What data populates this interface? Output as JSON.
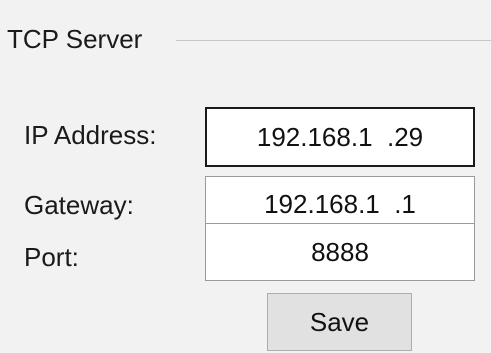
{
  "group": {
    "title": "TCP Server"
  },
  "fields": {
    "ip": {
      "label": "IP Address:",
      "value": "192.168.1  .29"
    },
    "gateway": {
      "label": "Gateway:",
      "value": "192.168.1  .1"
    },
    "port": {
      "label": "Port:",
      "value": "8888"
    }
  },
  "actions": {
    "save_label": "Save"
  }
}
